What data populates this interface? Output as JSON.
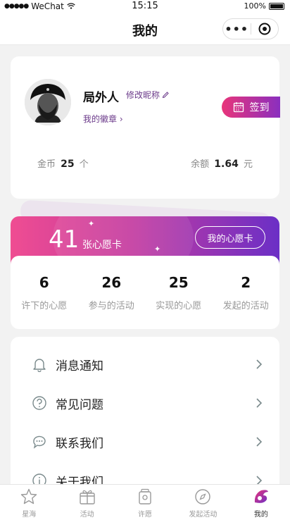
{
  "status_bar": {
    "carrier": "WeChat",
    "time": "15:15",
    "battery": "100%"
  },
  "nav": {
    "title": "我的",
    "more_icon": "more-dots-icon",
    "close_icon": "target-icon"
  },
  "profile": {
    "nickname": "局外人",
    "edit_nickname": "修改昵称",
    "badge_link": "我的徽章",
    "signin_label": "签到",
    "coins_label": "金币",
    "coins_value": "25",
    "coins_unit": "个",
    "balance_label": "余额",
    "balance_value": "1.64",
    "balance_unit": "元"
  },
  "wish": {
    "count": "41",
    "unit": "张心愿卡",
    "my_wish_button": "我的心愿卡",
    "stats": [
      {
        "value": "6",
        "label": "许下的心愿"
      },
      {
        "value": "26",
        "label": "参与的活动"
      },
      {
        "value": "25",
        "label": "实现的心愿"
      },
      {
        "value": "2",
        "label": "发起的活动"
      }
    ]
  },
  "menu": [
    {
      "label": "消息通知",
      "icon": "bell-icon"
    },
    {
      "label": "常见问题",
      "icon": "question-icon"
    },
    {
      "label": "联系我们",
      "icon": "chat-icon"
    },
    {
      "label": "关于我们",
      "icon": "info-icon"
    }
  ],
  "tabs": [
    {
      "label": "星海",
      "icon": "star-icon",
      "active": false
    },
    {
      "label": "活动",
      "icon": "gift-icon",
      "active": false
    },
    {
      "label": "许愿",
      "icon": "wish-jar-icon",
      "active": false
    },
    {
      "label": "发起活动",
      "icon": "compass-icon",
      "active": false
    },
    {
      "label": "我的",
      "icon": "profile-flame-icon",
      "active": true
    }
  ],
  "colors": {
    "accent_start": "#e8357a",
    "accent_end": "#8a2fbf",
    "link": "#6b3a8a"
  }
}
